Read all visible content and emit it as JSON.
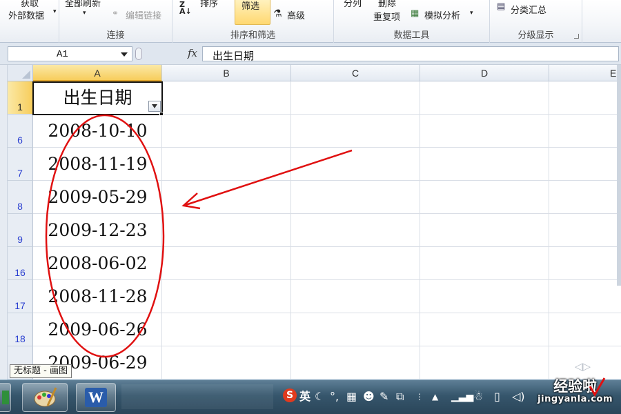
{
  "ribbon": {
    "get_external_line1": "获取",
    "get_external_line2": "外部数据",
    "refresh_all": "全部刷新",
    "edit_links": "编辑链接",
    "group_connections": "连接",
    "sort": "排序",
    "filter": "筛选",
    "advanced": "高级",
    "group_sort_filter": "排序和筛选",
    "text_to_columns": "分列",
    "remove_line1": "删除",
    "remove_line2": "重复项",
    "what_if": "模拟分析",
    "group_data_tools": "数据工具",
    "subtotal": "分类汇总",
    "group_outline": "分级显示"
  },
  "formula_bar": {
    "name_box": "A1",
    "fx": "fx",
    "content": "出生日期"
  },
  "columns": [
    "A",
    "B",
    "C",
    "D",
    "E"
  ],
  "rows": [
    {
      "num": "1",
      "value": "出生日期"
    },
    {
      "num": "6",
      "value": "2008-10-10"
    },
    {
      "num": "7",
      "value": "2008-11-19"
    },
    {
      "num": "8",
      "value": "2009-05-29"
    },
    {
      "num": "9",
      "value": "2009-12-23"
    },
    {
      "num": "16",
      "value": "2008-06-02"
    },
    {
      "num": "17",
      "value": "2008-11-28"
    },
    {
      "num": "18",
      "value": "2009-06-26"
    },
    {
      "num": "",
      "value": "2009-06-29"
    }
  ],
  "tooltip": "无标题 - 画图",
  "taskbar": {
    "ime_label": "英",
    "word_letter": "W"
  },
  "watermark": {
    "line1": "经验啦",
    "line2": "jingyanla.com"
  },
  "colors": {
    "annotation": "#e01010",
    "selected_header": "#f7cd5c",
    "row_number": "#2a3fd0"
  }
}
